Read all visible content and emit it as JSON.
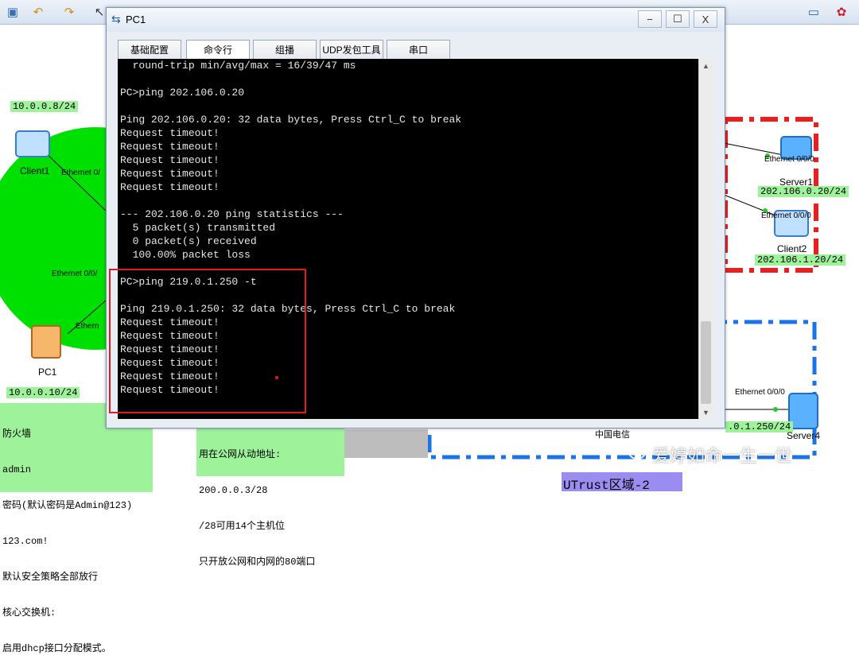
{
  "toolbar": {
    "icons_left": [
      "new-topology-icon",
      "undo-icon",
      "redo-icon",
      "select-pointer-icon",
      "hand-pan-icon",
      "delete-icon",
      "text-icon",
      "rectangle-icon",
      "ellipse-icon",
      "palette-icon",
      "zoom-icon",
      "start-icon",
      "stop-icon",
      "capture-icon",
      "topology-icon",
      "grid-icon"
    ],
    "icons_right": [
      "chat-icon",
      "huawei-logo-icon"
    ]
  },
  "canvas": {
    "labels": {
      "client1_ip": "10.0.0.8/24",
      "client1_name": "Client1",
      "client1_port": "Ethernet 0/",
      "pc1_port_a": "Ethernet 0/0/",
      "pc1_port_b": "Ethern",
      "pc1_name": "PC1",
      "pc1_ip": "10.0.0.10/24",
      "server1_port": "Ethernet 0/0/0",
      "server1_name": "Server1",
      "server1_ip": "202.106.0.20/24",
      "client2_port": "Ethernet 0/0/0",
      "client2_name": "Client2",
      "client2_ip": "202.106.1.20/24",
      "server4_port": "Ethernet 0/0/0",
      "server4_ip": ".0.1.250/24",
      "server4_name": "Server4",
      "isp_label": "中国电信",
      "zone_label": "UTrust区域-2"
    },
    "note_firewall": {
      "lines": [
        "防火墙",
        "admin",
        "密码(默认密码是Admin@123)",
        "123.com!",
        "默认安全策略全部放行",
        "核心交换机:",
        "启用dhcp接口分配模式。"
      ]
    },
    "note_nat": {
      "lines": [
        "用在公网从动地址:",
        "200.0.0.3/28",
        "/28可用14个主机位",
        "只开放公网和内网的80端口"
      ]
    }
  },
  "window": {
    "title": "PC1",
    "controls": {
      "minimize": "−",
      "maximize": "☐",
      "close": "X"
    },
    "tabs": [
      {
        "label": "基础配置",
        "active": false
      },
      {
        "label": "命令行",
        "active": true
      },
      {
        "label": "组播",
        "active": false
      },
      {
        "label": "UDP发包工具",
        "active": false
      },
      {
        "label": "串口",
        "active": false
      }
    ],
    "console_lines": [
      "  round-trip min/avg/max = 16/39/47 ms",
      "",
      "PC>ping 202.106.0.20",
      "",
      "Ping 202.106.0.20: 32 data bytes, Press Ctrl_C to break",
      "Request timeout!",
      "Request timeout!",
      "Request timeout!",
      "Request timeout!",
      "Request timeout!",
      "",
      "--- 202.106.0.20 ping statistics ---",
      "  5 packet(s) transmitted",
      "  0 packet(s) received",
      "  100.00% packet loss",
      "",
      "PC>ping 219.0.1.250 -t",
      "",
      "Ping 219.0.1.250: 32 data bytes, Press Ctrl_C to break",
      "Request timeout!",
      "Request timeout!",
      "Request timeout!",
      "Request timeout!",
      "Request timeout!",
      "Request timeout!"
    ]
  },
  "watermark": "爱婷如命一生一世",
  "colors": {
    "console_bg": "#000000",
    "console_text": "#e6e6e6",
    "label_green": "#9df29a",
    "highlight_red": "#e01b22",
    "zone_blue": "#1a73e8",
    "area_green": "#00e000"
  }
}
